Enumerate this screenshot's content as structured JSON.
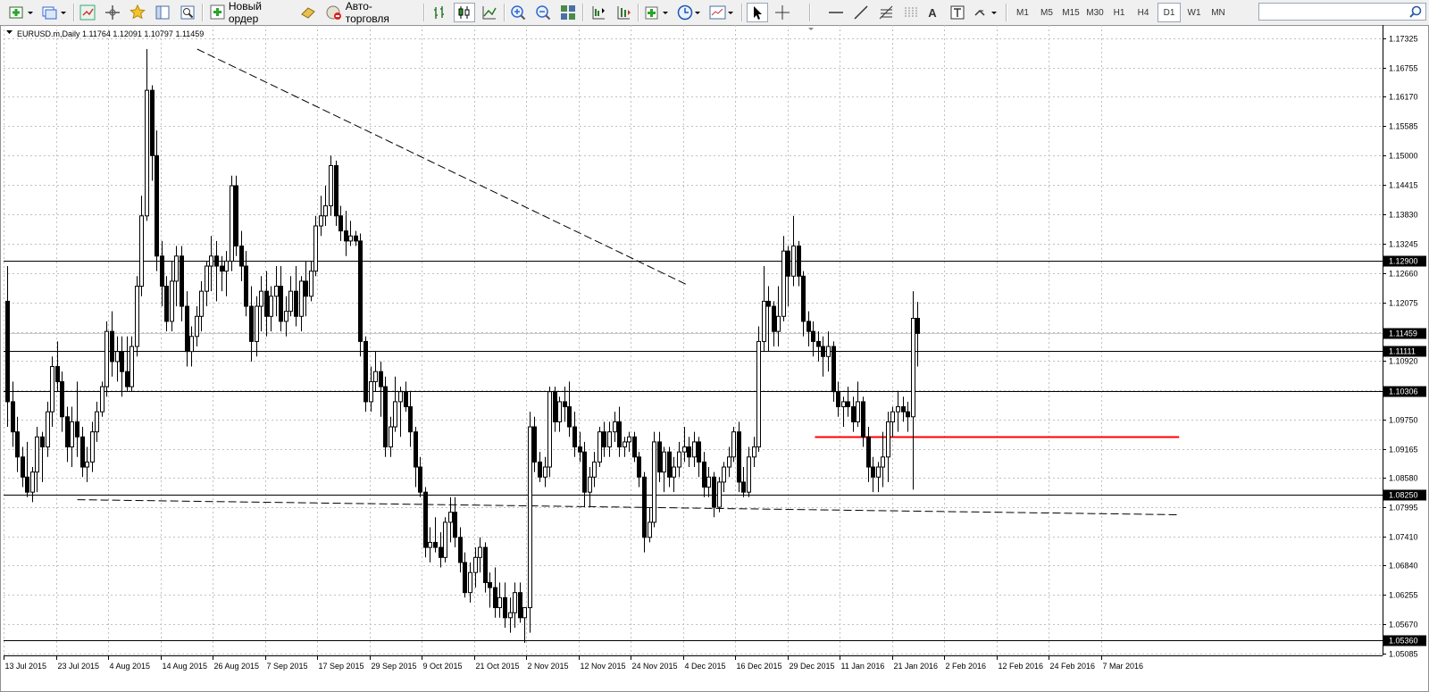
{
  "toolbar": {
    "new_order_label": "Новый ордер",
    "auto_trading_label": "Авто-торговля",
    "timeframes": [
      "M1",
      "M5",
      "M15",
      "M30",
      "H1",
      "H4",
      "D1",
      "W1",
      "MN"
    ],
    "active_timeframe": "D1",
    "search_placeholder": ""
  },
  "chart_data": {
    "type": "candlestick",
    "title": "EURUSD.m,Daily  1.11764 1.12091 1.10797 1.11459",
    "symbol": "EURUSD.m",
    "period": "Daily",
    "ohlc_header": {
      "open": 1.11764,
      "high": 1.12091,
      "low": 1.10797,
      "close": 1.11459
    },
    "ylim": [
      1.0505,
      1.176
    ],
    "y_ticks": [
      "1.17325",
      "1.16755",
      "1.16170",
      "1.15585",
      "1.15000",
      "1.14415",
      "1.13830",
      "1.13245",
      "1.12660",
      "1.12075",
      "1.11490",
      "1.10920",
      "1.10335",
      "1.09750",
      "1.09165",
      "1.08580",
      "1.07995",
      "1.07410",
      "1.06840",
      "1.06255",
      "1.05670",
      "1.05085"
    ],
    "x_labels": [
      "13 Jul 2015",
      "23 Jul 2015",
      "4 Aug 2015",
      "14 Aug 2015",
      "26 Aug 2015",
      "7 Sep 2015",
      "17 Sep 2015",
      "29 Sep 2015",
      "9 Oct 2015",
      "21 Oct 2015",
      "2 Nov 2015",
      "12 Nov 2015",
      "24 Nov 2015",
      "4 Dec 2015",
      "16 Dec 2015",
      "29 Dec 2015",
      "11 Jan 2016",
      "21 Jan 2016",
      "2 Feb 2016",
      "12 Feb 2016",
      "24 Feb 2016",
      "7 Mar 2016"
    ],
    "price_levels": [
      {
        "value": 1.129,
        "label": "1.12900",
        "highlight": true
      },
      {
        "value": 1.11459,
        "label": "1.11459",
        "highlight": true,
        "role": "current-price"
      },
      {
        "value": 1.11111,
        "label": "1.11111",
        "highlight": true
      },
      {
        "value": 1.10306,
        "label": "1.10306",
        "highlight": true
      },
      {
        "value": 1.0825,
        "label": "1.08250",
        "highlight": true
      },
      {
        "value": 1.0536,
        "label": "1.05360",
        "highlight": true
      }
    ],
    "trendlines": [
      {
        "style": "dashed",
        "from": {
          "date": "29 Jul 2015",
          "price": 1.0815
        },
        "to": {
          "date": "24 Mar 2016",
          "price": 1.0785
        }
      },
      {
        "style": "dashed",
        "from": {
          "date": "24 Aug 2015",
          "price": 1.1712
        },
        "to": {
          "date": "8 Dec 2015",
          "price": 1.1244
        }
      }
    ],
    "support_line": {
      "color": "#ff0000",
      "value": 1.094,
      "from": "5 Jan 2016",
      "to": "24 Mar 2016"
    },
    "grid": true,
    "candles": [
      [
        1.121,
        1.128,
        1.096,
        1.101
      ],
      [
        1.101,
        1.105,
        1.092,
        1.095
      ],
      [
        1.095,
        1.098,
        1.087,
        1.09
      ],
      [
        1.09,
        1.092,
        1.084,
        1.086
      ],
      [
        1.086,
        1.093,
        1.082,
        1.083
      ],
      [
        1.083,
        1.088,
        1.081,
        1.087
      ],
      [
        1.087,
        1.096,
        1.083,
        1.094
      ],
      [
        1.094,
        1.095,
        1.085,
        1.092
      ],
      [
        1.092,
        1.101,
        1.09,
        1.099
      ],
      [
        1.099,
        1.11,
        1.096,
        1.108
      ],
      [
        1.108,
        1.113,
        1.103,
        1.105
      ],
      [
        1.105,
        1.107,
        1.095,
        1.098
      ],
      [
        1.098,
        1.1,
        1.089,
        1.092
      ],
      [
        1.092,
        1.1,
        1.088,
        1.097
      ],
      [
        1.097,
        1.105,
        1.09,
        1.094
      ],
      [
        1.094,
        1.096,
        1.086,
        1.088
      ],
      [
        1.088,
        1.092,
        1.085,
        1.089
      ],
      [
        1.089,
        1.097,
        1.087,
        1.095
      ],
      [
        1.095,
        1.101,
        1.093,
        1.099
      ],
      [
        1.099,
        1.105,
        1.098,
        1.104
      ],
      [
        1.104,
        1.117,
        1.102,
        1.115
      ],
      [
        1.115,
        1.119,
        1.106,
        1.109
      ],
      [
        1.109,
        1.114,
        1.105,
        1.111
      ],
      [
        1.111,
        1.114,
        1.102,
        1.107
      ],
      [
        1.107,
        1.114,
        1.103,
        1.104
      ],
      [
        1.104,
        1.114,
        1.103,
        1.112
      ],
      [
        1.112,
        1.126,
        1.11,
        1.124
      ],
      [
        1.124,
        1.142,
        1.122,
        1.138
      ],
      [
        1.138,
        1.1712,
        1.137,
        1.163
      ],
      [
        1.163,
        1.164,
        1.145,
        1.15
      ],
      [
        1.15,
        1.155,
        1.127,
        1.13
      ],
      [
        1.13,
        1.133,
        1.12,
        1.124
      ],
      [
        1.124,
        1.126,
        1.115,
        1.117
      ],
      [
        1.117,
        1.129,
        1.115,
        1.125
      ],
      [
        1.125,
        1.132,
        1.12,
        1.13
      ],
      [
        1.13,
        1.132,
        1.117,
        1.12
      ],
      [
        1.12,
        1.123,
        1.108,
        1.111
      ],
      [
        1.111,
        1.116,
        1.108,
        1.114
      ],
      [
        1.114,
        1.12,
        1.112,
        1.118
      ],
      [
        1.118,
        1.125,
        1.115,
        1.123
      ],
      [
        1.123,
        1.129,
        1.12,
        1.128
      ],
      [
        1.128,
        1.134,
        1.123,
        1.13
      ],
      [
        1.13,
        1.133,
        1.121,
        1.128
      ],
      [
        1.128,
        1.13,
        1.123,
        1.127
      ],
      [
        1.127,
        1.131,
        1.122,
        1.129
      ],
      [
        1.129,
        1.146,
        1.127,
        1.144
      ],
      [
        1.144,
        1.146,
        1.13,
        1.132
      ],
      [
        1.132,
        1.135,
        1.125,
        1.128
      ],
      [
        1.128,
        1.131,
        1.118,
        1.12
      ],
      [
        1.12,
        1.124,
        1.109,
        1.113
      ],
      [
        1.113,
        1.122,
        1.11,
        1.12
      ],
      [
        1.12,
        1.126,
        1.115,
        1.123
      ],
      [
        1.123,
        1.127,
        1.114,
        1.118
      ],
      [
        1.118,
        1.124,
        1.115,
        1.122
      ],
      [
        1.122,
        1.128,
        1.118,
        1.124
      ],
      [
        1.124,
        1.128,
        1.115,
        1.117
      ],
      [
        1.117,
        1.122,
        1.114,
        1.119
      ],
      [
        1.119,
        1.126,
        1.118,
        1.123
      ],
      [
        1.123,
        1.128,
        1.116,
        1.118
      ],
      [
        1.118,
        1.126,
        1.115,
        1.125
      ],
      [
        1.125,
        1.129,
        1.118,
        1.122
      ],
      [
        1.122,
        1.129,
        1.121,
        1.127
      ],
      [
        1.127,
        1.138,
        1.126,
        1.136
      ],
      [
        1.136,
        1.142,
        1.134,
        1.138
      ],
      [
        1.138,
        1.144,
        1.136,
        1.14
      ],
      [
        1.14,
        1.15,
        1.138,
        1.148
      ],
      [
        1.148,
        1.149,
        1.136,
        1.138
      ],
      [
        1.138,
        1.14,
        1.133,
        1.135
      ],
      [
        1.135,
        1.139,
        1.13,
        1.133
      ],
      [
        1.133,
        1.137,
        1.132,
        1.134
      ],
      [
        1.134,
        1.135,
        1.132,
        1.133
      ],
      [
        1.133,
        1.1345,
        1.11,
        1.113
      ],
      [
        1.113,
        1.114,
        1.099,
        1.101
      ],
      [
        1.101,
        1.108,
        1.099,
        1.105
      ],
      [
        1.105,
        1.111,
        1.103,
        1.107
      ],
      [
        1.107,
        1.109,
        1.098,
        1.104
      ],
      [
        1.104,
        1.106,
        1.09,
        1.092
      ],
      [
        1.092,
        1.098,
        1.09,
        1.096
      ],
      [
        1.096,
        1.106,
        1.095,
        1.101
      ],
      [
        1.101,
        1.104,
        1.094,
        1.103
      ],
      [
        1.103,
        1.105,
        1.099,
        1.1
      ],
      [
        1.1,
        1.103,
        1.092,
        1.095
      ],
      [
        1.095,
        1.096,
        1.084,
        1.088
      ],
      [
        1.088,
        1.09,
        1.082,
        1.083
      ],
      [
        1.083,
        1.084,
        1.07,
        1.072
      ],
      [
        1.072,
        1.076,
        1.069,
        1.073
      ],
      [
        1.073,
        1.078,
        1.071,
        1.072
      ],
      [
        1.072,
        1.075,
        1.068,
        1.07
      ],
      [
        1.07,
        1.078,
        1.069,
        1.077
      ],
      [
        1.077,
        1.082,
        1.073,
        1.079
      ],
      [
        1.079,
        1.082,
        1.072,
        1.074
      ],
      [
        1.074,
        1.076,
        1.067,
        1.069
      ],
      [
        1.069,
        1.071,
        1.062,
        1.063
      ],
      [
        1.063,
        1.069,
        1.061,
        1.067
      ],
      [
        1.067,
        1.072,
        1.064,
        1.07
      ],
      [
        1.07,
        1.074,
        1.067,
        1.072
      ],
      [
        1.072,
        1.073,
        1.063,
        1.065
      ],
      [
        1.065,
        1.067,
        1.06,
        1.064
      ],
      [
        1.064,
        1.068,
        1.058,
        1.06
      ],
      [
        1.06,
        1.065,
        1.058,
        1.062
      ],
      [
        1.062,
        1.065,
        1.056,
        1.058
      ],
      [
        1.058,
        1.062,
        1.055,
        1.059
      ],
      [
        1.059,
        1.065,
        1.056,
        1.063
      ],
      [
        1.063,
        1.065,
        1.057,
        1.058
      ],
      [
        1.058,
        1.06,
        1.053,
        1.06
      ],
      [
        1.06,
        1.099,
        1.055,
        1.096
      ],
      [
        1.096,
        1.098,
        1.087,
        1.089
      ],
      [
        1.089,
        1.091,
        1.085,
        1.086
      ],
      [
        1.086,
        1.09,
        1.084,
        1.088
      ],
      [
        1.088,
        1.104,
        1.086,
        1.103
      ],
      [
        1.103,
        1.104,
        1.095,
        1.097
      ],
      [
        1.097,
        1.102,
        1.095,
        1.101
      ],
      [
        1.101,
        1.104,
        1.097,
        1.1
      ],
      [
        1.1,
        1.105,
        1.094,
        1.096
      ],
      [
        1.096,
        1.099,
        1.09,
        1.092
      ],
      [
        1.092,
        1.095,
        1.089,
        1.091
      ],
      [
        1.091,
        1.093,
        1.08,
        1.083
      ],
      [
        1.083,
        1.088,
        1.08,
        1.086
      ],
      [
        1.086,
        1.091,
        1.084,
        1.089
      ],
      [
        1.089,
        1.096,
        1.088,
        1.095
      ],
      [
        1.095,
        1.097,
        1.09,
        1.092
      ],
      [
        1.092,
        1.097,
        1.09,
        1.095
      ],
      [
        1.095,
        1.099,
        1.093,
        1.097
      ],
      [
        1.097,
        1.1,
        1.09,
        1.092
      ],
      [
        1.092,
        1.094,
        1.09,
        1.093
      ],
      [
        1.093,
        1.095,
        1.091,
        1.094
      ],
      [
        1.094,
        1.095,
        1.089,
        1.09
      ],
      [
        1.09,
        1.091,
        1.084,
        1.086
      ],
      [
        1.086,
        1.087,
        1.071,
        1.074
      ],
      [
        1.074,
        1.08,
        1.073,
        1.077
      ],
      [
        1.077,
        1.095,
        1.076,
        1.093
      ],
      [
        1.093,
        1.095,
        1.085,
        1.087
      ],
      [
        1.087,
        1.092,
        1.083,
        1.091
      ],
      [
        1.091,
        1.092,
        1.084,
        1.086
      ],
      [
        1.086,
        1.09,
        1.083,
        1.088
      ],
      [
        1.088,
        1.093,
        1.086,
        1.091
      ],
      [
        1.091,
        1.096,
        1.089,
        1.092
      ],
      [
        1.092,
        1.094,
        1.088,
        1.09
      ],
      [
        1.09,
        1.095,
        1.088,
        1.093
      ],
      [
        1.093,
        1.094,
        1.086,
        1.089
      ],
      [
        1.089,
        1.091,
        1.082,
        1.084
      ],
      [
        1.084,
        1.088,
        1.082,
        1.086
      ],
      [
        1.086,
        1.087,
        1.078,
        1.08
      ],
      [
        1.08,
        1.086,
        1.079,
        1.085
      ],
      [
        1.085,
        1.089,
        1.083,
        1.088
      ],
      [
        1.088,
        1.092,
        1.086,
        1.09
      ],
      [
        1.09,
        1.096,
        1.089,
        1.095
      ],
      [
        1.095,
        1.097,
        1.083,
        1.085
      ],
      [
        1.085,
        1.088,
        1.082,
        1.083
      ],
      [
        1.083,
        1.092,
        1.082,
        1.09
      ],
      [
        1.09,
        1.094,
        1.088,
        1.092
      ],
      [
        1.092,
        1.116,
        1.091,
        1.113
      ],
      [
        1.113,
        1.128,
        1.111,
        1.121
      ],
      [
        1.121,
        1.124,
        1.111,
        1.12
      ],
      [
        1.12,
        1.121,
        1.112,
        1.115
      ],
      [
        1.115,
        1.124,
        1.112,
        1.118
      ],
      [
        1.118,
        1.134,
        1.117,
        1.131
      ],
      [
        1.131,
        1.132,
        1.12,
        1.126
      ],
      [
        1.126,
        1.138,
        1.124,
        1.132
      ],
      [
        1.132,
        1.133,
        1.124,
        1.126
      ],
      [
        1.126,
        1.127,
        1.114,
        1.117
      ],
      [
        1.117,
        1.119,
        1.112,
        1.115
      ],
      [
        1.115,
        1.117,
        1.11,
        1.113
      ],
      [
        1.113,
        1.115,
        1.109,
        1.112
      ],
      [
        1.112,
        1.114,
        1.106,
        1.11
      ],
      [
        1.11,
        1.115,
        1.107,
        1.112
      ],
      [
        1.112,
        1.113,
        1.101,
        1.103
      ],
      [
        1.103,
        1.105,
        1.098,
        1.1
      ],
      [
        1.1,
        1.102,
        1.096,
        1.101
      ],
      [
        1.101,
        1.104,
        1.098,
        1.1
      ],
      [
        1.1,
        1.102,
        1.095,
        1.097
      ],
      [
        1.097,
        1.105,
        1.096,
        1.101
      ],
      [
        1.101,
        1.102,
        1.092,
        1.094
      ],
      [
        1.094,
        1.096,
        1.085,
        1.088
      ],
      [
        1.088,
        1.09,
        1.083,
        1.086
      ],
      [
        1.086,
        1.089,
        1.083,
        1.088
      ],
      [
        1.088,
        1.095,
        1.084,
        1.09
      ],
      [
        1.09,
        1.099,
        1.085,
        1.097
      ],
      [
        1.097,
        1.1,
        1.094,
        1.099
      ],
      [
        1.099,
        1.103,
        1.095,
        1.1
      ],
      [
        1.1,
        1.102,
        1.097,
        1.099
      ],
      [
        1.099,
        1.101,
        1.095,
        1.098
      ],
      [
        1.098,
        1.123,
        1.0835,
        1.1176
      ],
      [
        1.1176,
        1.1209,
        1.108,
        1.1146
      ]
    ]
  }
}
